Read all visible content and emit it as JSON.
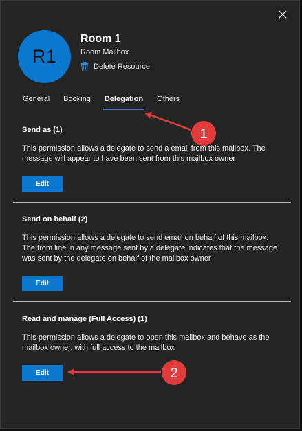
{
  "header": {
    "avatar_initials": "R1",
    "room_name": "Room 1",
    "room_type": "Room Mailbox",
    "delete_label": "Delete Resource"
  },
  "tabs": [
    {
      "label": "General",
      "active": false
    },
    {
      "label": "Booking",
      "active": false
    },
    {
      "label": "Delegation",
      "active": true
    },
    {
      "label": "Others",
      "active": false
    }
  ],
  "sections": [
    {
      "title": "Send as (1)",
      "description": "This permission allows a delegate to send a email from this mailbox. The message will appear to have been sent from this mailbox owner",
      "edit_label": "Edit"
    },
    {
      "title": "Send on behalf (2)",
      "description": "This permission allows a delegate to send email on behalf of this mailbox. The from line in any message sent by a delegate indicates that the message was sent by the delegate on behalf of the mailbox owner",
      "edit_label": "Edit"
    },
    {
      "title": "Read and manage (Full Access) (1)",
      "description": "This permission allows a delegate to open this mailbox and behave as the mailbox owner, with full access to the mailbox",
      "edit_label": "Edit"
    }
  ],
  "annotations": [
    {
      "label": "1"
    },
    {
      "label": "2"
    }
  ],
  "icons": {
    "close": "close-icon",
    "delete": "trash-icon"
  },
  "colors": {
    "accent": "#0b78d0",
    "panel_bg": "#242424",
    "annotation_red": "#e03c3c"
  }
}
